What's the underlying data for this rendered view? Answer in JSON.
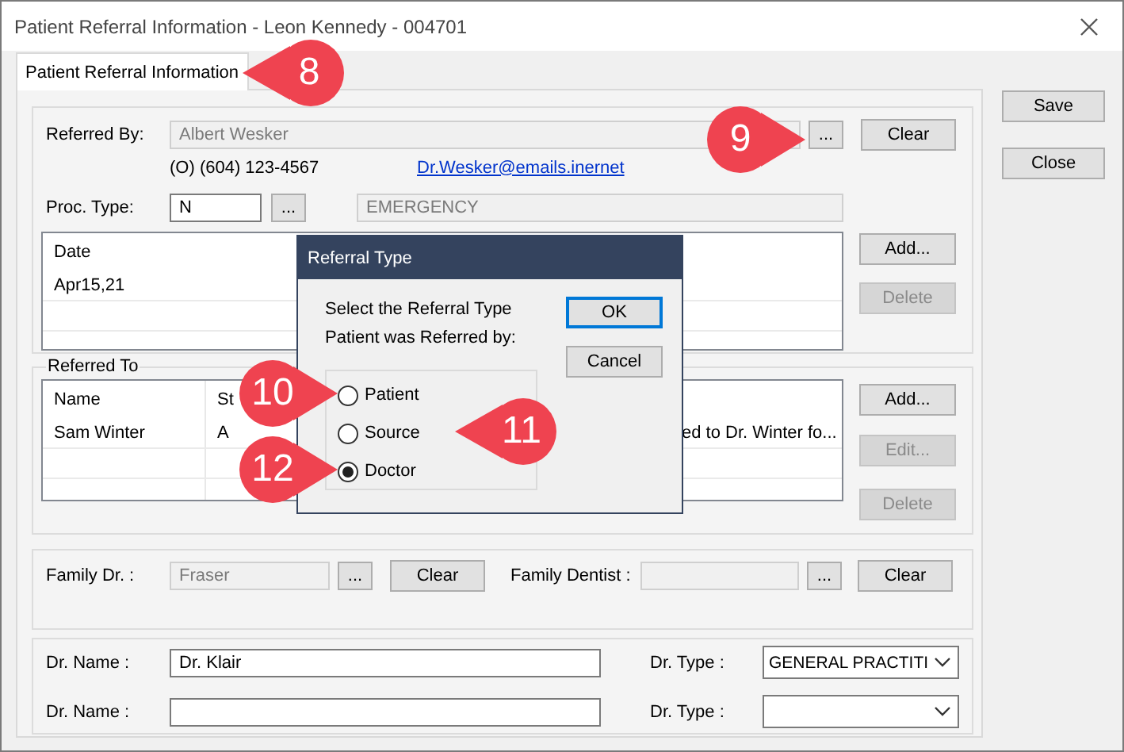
{
  "window": {
    "title": "Patient Referral Information - Leon Kennedy - 004701"
  },
  "tabs": [
    {
      "label": "Patient Referral Information",
      "selected": true
    }
  ],
  "side_buttons": [
    "Save",
    "Close"
  ],
  "referred_by": {
    "label": "Referred By:",
    "value": "Albert Wesker",
    "disabled": true,
    "browse": "...",
    "clear": "Clear",
    "phone": "(O) (604) 123-4567",
    "email": "Dr.Wesker@emails.inernet"
  },
  "proc_type": {
    "label": "Proc. Type:",
    "value": "N",
    "browse": "...",
    "description": "EMERGENCY"
  },
  "dates": {
    "columns": [
      "Date"
    ],
    "rows": [
      [
        "Apr15,21"
      ]
    ],
    "buttons": [
      {
        "label": "Add...",
        "disabled": false
      },
      {
        "label": "Delete",
        "disabled": true
      }
    ]
  },
  "referred_to": {
    "legend": "Referred To",
    "columns": [
      "Name",
      "St"
    ],
    "rows": [
      [
        "Sam Winter",
        "A",
        "ed to Dr. Winter fo..."
      ]
    ],
    "buttons": [
      {
        "label": "Add...",
        "disabled": false
      },
      {
        "label": "Edit...",
        "disabled": true
      },
      {
        "label": "Delete",
        "disabled": true
      }
    ]
  },
  "family": [
    {
      "label": "Family Dr. :",
      "value": "Fraser",
      "disabled": true,
      "browse": "...",
      "clear": "Clear"
    },
    {
      "label": "Family Dentist :",
      "disabled": true,
      "browse": "...",
      "clear": "Clear"
    }
  ],
  "doctors": [
    {
      "name_label": "Dr. Name :",
      "name": "Dr. Klair",
      "type_label": "Dr. Type :",
      "type": "GENERAL PRACTITI"
    },
    {
      "name_label": "Dr. Name :",
      "type_label": "Dr. Type :"
    }
  ],
  "dialog": {
    "title": "Referral Type",
    "prompt": "Select the Referral Type\nPatient was Referred by:",
    "options": [
      {
        "label": "Patient",
        "selected": false
      },
      {
        "label": "Source",
        "selected": false
      },
      {
        "label": "Doctor",
        "selected": true
      }
    ],
    "buttons": [
      {
        "label": "OK",
        "default": true
      },
      {
        "label": "Cancel",
        "default": false
      }
    ]
  },
  "callouts": [
    {
      "number": "8",
      "kind": "left"
    },
    {
      "number": "9",
      "kind": "right"
    },
    {
      "number": "10",
      "kind": "right"
    },
    {
      "number": "11",
      "kind": "left"
    },
    {
      "number": "12",
      "kind": "right"
    }
  ]
}
